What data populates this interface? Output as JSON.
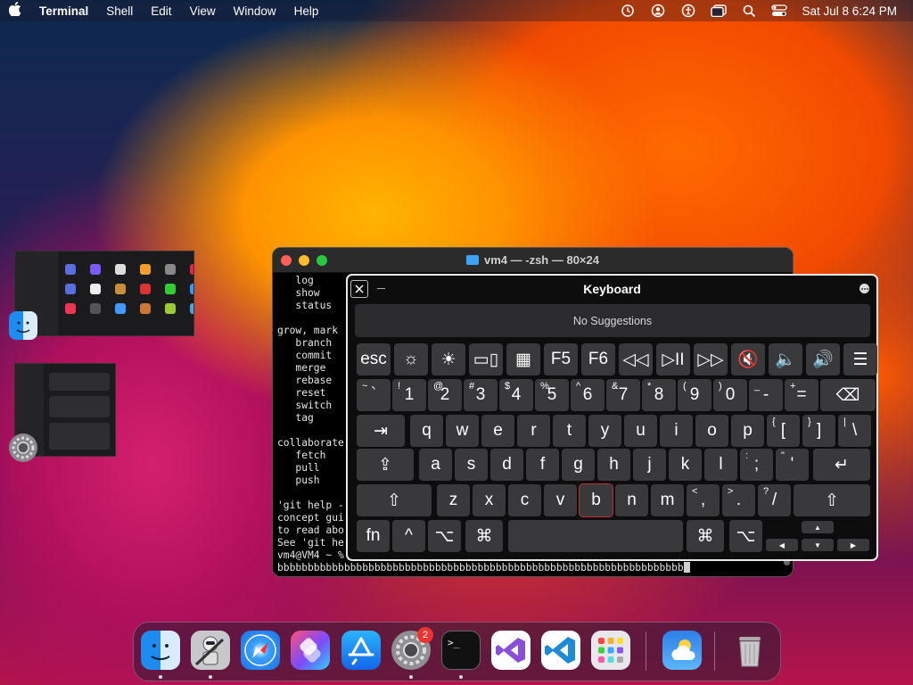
{
  "menubar": {
    "app_name": "Terminal",
    "menus": [
      "Shell",
      "Edit",
      "View",
      "Window",
      "Help"
    ],
    "clock": "Sat Jul 8  6:24 PM",
    "status_icons": [
      "time-machine-icon",
      "user-icon",
      "accessibility-icon",
      "window-icon",
      "search-icon",
      "control-center-icon"
    ]
  },
  "terminal": {
    "title": "vm4 — -zsh — 80×24",
    "lines": [
      "   log",
      "   show",
      "   status",
      "",
      "grow, mark",
      "   branch",
      "   commit",
      "   merge",
      "   rebase",
      "   reset",
      "   switch",
      "   tag",
      "",
      "collaborate",
      "   fetch",
      "   pull",
      "   push",
      "",
      "'git help -",
      "concept gui",
      "to read abo",
      "See 'git he",
      "vm4@VM4 ~ %",
      "bbbbbbbbbbbbbbbbbbbbbbbbbbbbbbbbbbbbbbbbbbbbbbbbbbbbbbbbbbbbbbbbbbb"
    ]
  },
  "keyboard": {
    "title": "Keyboard",
    "suggestions": "No Suggestions",
    "fn_row": [
      "esc",
      "☼",
      "☀",
      "▭▯",
      "▦",
      "F5",
      "F6",
      "◁◁",
      "▷II",
      "▷▷",
      "🔇",
      "🔈",
      "🔊",
      "☰"
    ],
    "number_row": [
      {
        "sub": "~",
        "main": "`"
      },
      {
        "sub": "!",
        "main": "1"
      },
      {
        "sub": "@",
        "main": "2"
      },
      {
        "sub": "#",
        "main": "3"
      },
      {
        "sub": "$",
        "main": "4"
      },
      {
        "sub": "%",
        "main": "5"
      },
      {
        "sub": "^",
        "main": "6"
      },
      {
        "sub": "&",
        "main": "7"
      },
      {
        "sub": "*",
        "main": "8"
      },
      {
        "sub": "(",
        "main": "9"
      },
      {
        "sub": ")",
        "main": "0"
      },
      {
        "sub": "_",
        "main": "-"
      },
      {
        "sub": "+",
        "main": "="
      },
      {
        "sub": "",
        "main": "⌫"
      }
    ],
    "row_q": [
      "⇥",
      "q",
      "w",
      "e",
      "r",
      "t",
      "y",
      "u",
      "i",
      "o",
      "p"
    ],
    "row_q_brackets": [
      {
        "sub": "{",
        "main": "["
      },
      {
        "sub": "}",
        "main": "]"
      },
      {
        "sub": "|",
        "main": "\\"
      }
    ],
    "row_a": [
      "⇪",
      "a",
      "s",
      "d",
      "f",
      "g",
      "h",
      "j",
      "k",
      "l"
    ],
    "row_a_punct": [
      {
        "sub": ":",
        "main": ";"
      },
      {
        "sub": "\"",
        "main": "'"
      },
      {
        "sub": "",
        "main": "↵"
      }
    ],
    "row_z": [
      "⇧",
      "z",
      "x",
      "c",
      "v",
      "b",
      "n",
      "m"
    ],
    "row_z_punct": [
      {
        "sub": "<",
        "main": ","
      },
      {
        "sub": ">",
        "main": "."
      },
      {
        "sub": "?",
        "main": "/"
      },
      {
        "sub": "",
        "main": "⇧"
      }
    ],
    "bottom_row": [
      "fn",
      "^",
      "⌥",
      "⌘",
      "",
      "⌘",
      "⌥"
    ],
    "arrows": [
      "▲",
      "◀",
      "▼",
      "▶"
    ]
  },
  "dock": {
    "apps": [
      {
        "name": "finder-icon",
        "running": true
      },
      {
        "name": "automator-icon",
        "running": true
      },
      {
        "name": "safari-icon",
        "running": false
      },
      {
        "name": "shortcuts-icon",
        "running": false
      },
      {
        "name": "app-store-icon",
        "running": false
      },
      {
        "name": "system-settings-icon",
        "running": true,
        "badge": "2"
      },
      {
        "name": "terminal-icon",
        "running": true
      },
      {
        "name": "visual-studio-icon",
        "running": false
      },
      {
        "name": "vscode-icon",
        "running": false
      },
      {
        "name": "launchpad-icon",
        "running": false
      },
      {
        "name": "weather-icon",
        "running": false
      },
      {
        "name": "trash-icon",
        "running": false
      }
    ],
    "terminal_glyph": ">_"
  }
}
